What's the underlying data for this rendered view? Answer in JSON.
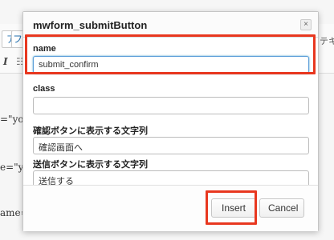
{
  "background": {
    "toolbar_button_1": "ア",
    "toolbar_button_2": "フ",
    "italic_label": "I",
    "list_icon": "☷",
    "right_label": "テキ",
    "code_line_1": "=\"you",
    "code_line_2": "e=\"yo",
    "code_line_3": "ame='"
  },
  "dialog": {
    "title": "mwform_submitButton",
    "close_symbol": "×",
    "fields": {
      "name": {
        "label": "name",
        "value": "submit_confirm"
      },
      "class": {
        "label": "class",
        "value": ""
      },
      "confirm_button_text": {
        "label": "確認ボタンに表示する文字列",
        "value": "確認画面へ"
      },
      "submit_button_text": {
        "label": "送信ボタンに表示する文字列",
        "value": "送信する"
      }
    },
    "buttons": {
      "insert": "Insert",
      "cancel": "Cancel"
    }
  },
  "colors": {
    "highlight": "#e8371f",
    "focus": "#5b9dd9"
  }
}
